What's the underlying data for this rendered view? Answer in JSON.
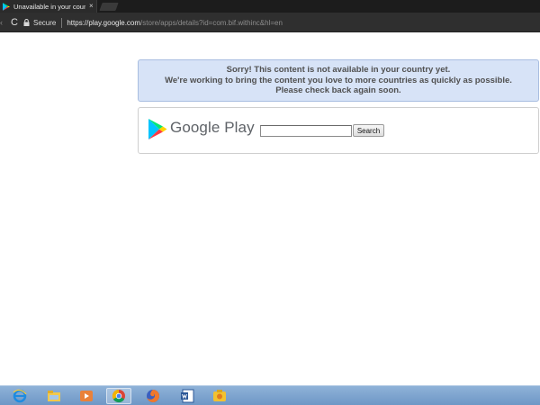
{
  "browser": {
    "tab": {
      "title": "Unavailable in your coun",
      "close_glyph": "×",
      "favicon": "google-play-icon"
    },
    "toolbar": {
      "back_glyph": "‹",
      "reload_glyph": "C",
      "secure_label": "Secure",
      "url_main": "https://play.google.com",
      "url_rest": "/store/apps/details?id=com.bif.withinc&hl=en"
    }
  },
  "notice": {
    "line1": "Sorry! This content is not available in your country yet.",
    "line2": "We're working to bring the content you love to more countries as quickly as possible.",
    "line3": "Please check back again soon."
  },
  "store": {
    "brand": "Google Play",
    "search_value": "",
    "search_button": "Search"
  },
  "taskbar": {
    "icons": [
      "internet-explorer-icon",
      "file-explorer-icon",
      "media-player-icon",
      "chrome-icon",
      "firefox-icon",
      "word-icon",
      "misc-app-icon"
    ],
    "active": "chrome-icon"
  },
  "colors": {
    "notice_bg": "#d7e3f7",
    "notice_border": "#a8bde0",
    "chrome_dark": "#2f2f2f",
    "taskbar": "#7fa6d0"
  }
}
